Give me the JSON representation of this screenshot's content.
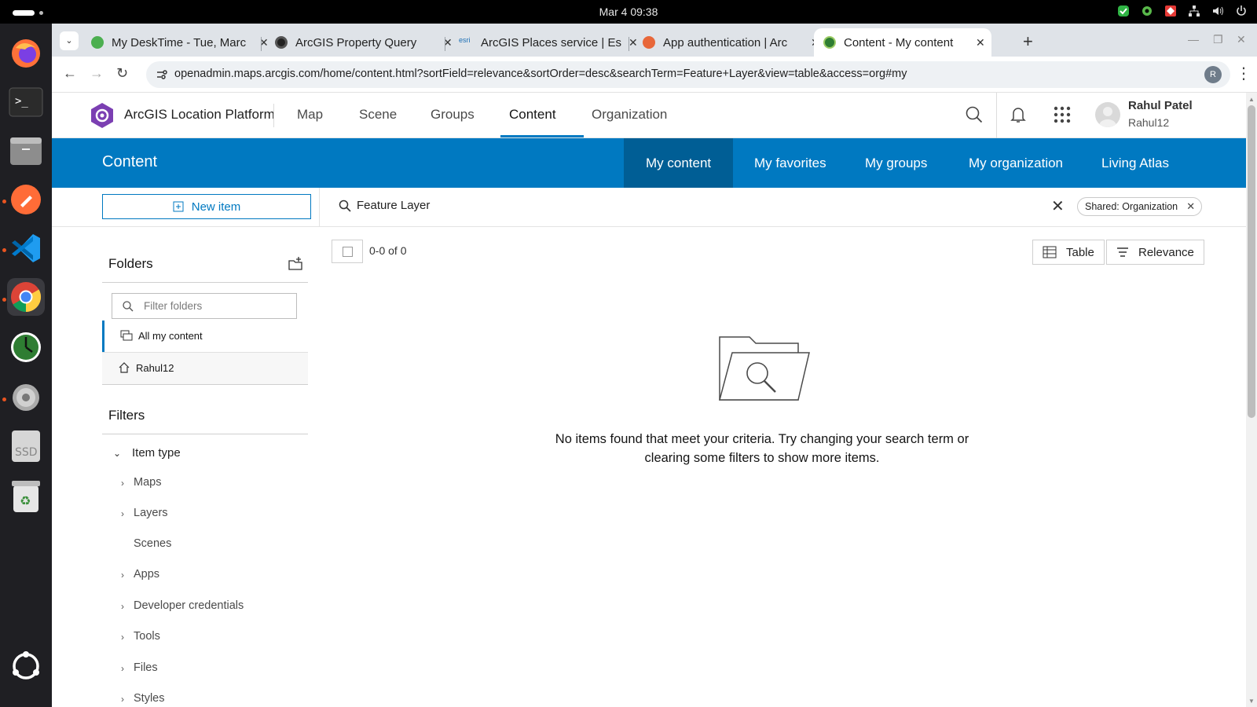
{
  "system": {
    "clock": "Mar 4  09:38"
  },
  "browser": {
    "tabs": [
      {
        "title": "My DeskTime - Tue, Marc",
        "color": "#4caf50"
      },
      {
        "title": "ArcGIS Property Query",
        "color": "#222222"
      },
      {
        "title": "ArcGIS Places service | Es",
        "color": "#1b6fb5",
        "favtext": "esri"
      },
      {
        "title": "App authentication | Arc",
        "color": "#e8673a"
      },
      {
        "title": "Content - My content",
        "color": "#2e7d32"
      }
    ],
    "url": "openadmin.maps.arcgis.com/home/content.html?sortField=relevance&sortOrder=desc&searchTerm=Feature+Layer&view=table&access=org#my",
    "profile_initial": "R"
  },
  "header": {
    "brand": "ArcGIS Location Platform",
    "nav": [
      "Map",
      "Scene",
      "Groups",
      "Content",
      "Organization"
    ],
    "active_nav": "Content",
    "user_name": "Rahul Patel",
    "user_id": "Rahul12"
  },
  "content_bar": {
    "title": "Content",
    "tabs": [
      "My content",
      "My favorites",
      "My groups",
      "My organization",
      "Living Atlas"
    ]
  },
  "toolbar": {
    "new_item": "New item",
    "search_term": "Feature Layer",
    "filter_chip": "Shared: Organization"
  },
  "folders": {
    "title": "Folders",
    "filter_placeholder": "Filter folders",
    "items": [
      "All my content",
      "Rahul12"
    ]
  },
  "filters": {
    "title": "Filters",
    "item_type_label": "Item type",
    "types": [
      "Maps",
      "Layers",
      "Scenes",
      "Apps",
      "Developer credentials",
      "Tools",
      "Files",
      "Styles"
    ]
  },
  "results": {
    "count": "0-0 of 0",
    "view_label": "Table",
    "sort_label": "Relevance",
    "empty_line1": "No items found that meet your criteria. Try changing your search term or",
    "empty_line2": "clearing some filters to show more items."
  },
  "colors": {
    "accent": "#0079c1",
    "accent_dark": "#005e95"
  }
}
